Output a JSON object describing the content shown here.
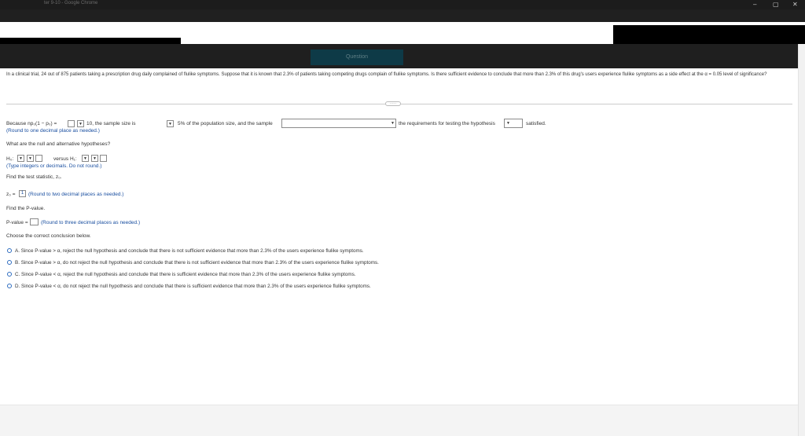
{
  "window": {
    "title": "ter 9-10 - Google Chrome",
    "minimize": "–",
    "restore": "▢",
    "close": "✕"
  },
  "question_tab": "Question",
  "question": {
    "text": "In a clinical trial, 24 out of 875 patients taking a prescription drug daily complained of flulike symptoms. Suppose that it is known that 2.3% of patients taking competing drugs complain of flulike symptoms. Is there sufficient evidence to conclude that more than 2.3% of this drug's users experience flulike symptoms as a side effect at the α = 0.05 level of significance?"
  },
  "more_button": "·····",
  "step1": {
    "because": "Because np₀(1 − p₀) =",
    "ten": "10, the sample size is",
    "pct": "5% of the population size, and the sample",
    "req": "the requirements for testing the hypothesis",
    "satisfied": "satisfied.",
    "round_hint": "(Round to one decimal place as needed.)"
  },
  "step2": {
    "question": "What are the null and alternative hypotheses?",
    "h0": "H₀:",
    "versus": "versus H₁:",
    "hint": "(Type integers or decimals. Do not round.)"
  },
  "step3": {
    "question": "Find the test statistic, z₀.",
    "z0": "z₀ =",
    "answer_mark": "1",
    "hint": "(Round to two decimal places as needed.)"
  },
  "step4": {
    "question": "Find the P-value.",
    "pvalue": "P-value =",
    "hint": "(Round to three decimal places as needed.)"
  },
  "step5": {
    "question": "Choose the correct conclusion below.",
    "options": [
      "A.   Since P-value > α, reject the null hypothesis and conclude that there is not sufficient evidence that more than 2.3% of the users experience flulike symptoms.",
      "B.   Since P-value > α, do not reject the null hypothesis and conclude that there is not sufficient evidence that more than 2.3% of the users experience flulike symptoms.",
      "C.   Since P-value < α, reject the null hypothesis and conclude that there is sufficient evidence that more than 2.3% of the users experience flulike symptoms.",
      "D.   Since P-value < α, do not reject the null hypothesis and conclude that there is sufficient evidence that more than 2.3% of the users experience flulike symptoms."
    ]
  }
}
